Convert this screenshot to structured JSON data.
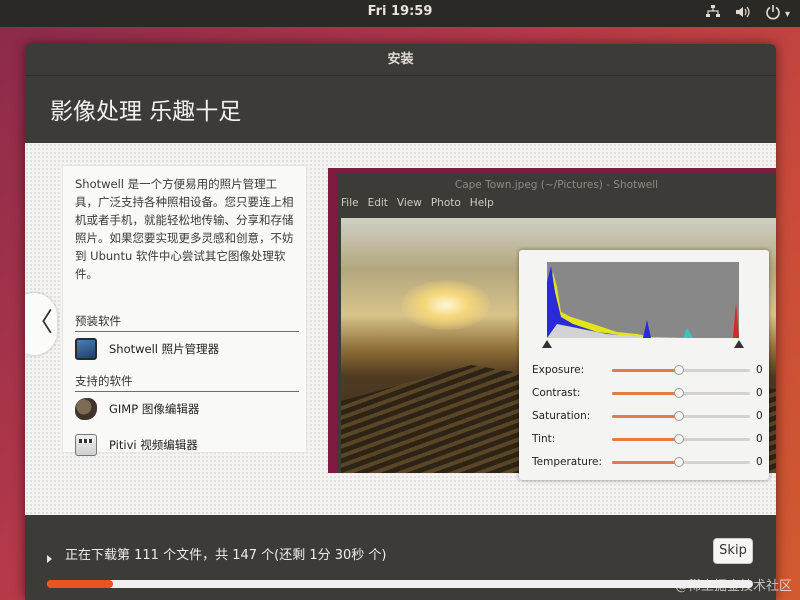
{
  "topbar": {
    "clock": "Fri 19:59",
    "tray_icons": [
      "network-icon",
      "volume-icon",
      "power-icon",
      "chevron-down-icon"
    ]
  },
  "window": {
    "title": "安装",
    "heading": "影像处理 乐趣十足"
  },
  "slide": {
    "description": "Shotwell 是一个方便易用的照片管理工具，广泛支持各种照相设备。您只要连上相机或者手机，就能轻松地传输、分享和存储照片。如果您要实现更多灵感和创意，不妨到 Ubuntu 软件中心尝试其它图像处理软件。",
    "preinstalled_title": "预装软件",
    "preinstalled_apps": [
      {
        "label": "Shotwell 照片管理器",
        "icon": "shotwell-icon"
      }
    ],
    "supported_title": "支持的软件",
    "supported_apps": [
      {
        "label": "GIMP 图像编辑器",
        "icon": "gimp-icon"
      },
      {
        "label": "Pitivi 视频编辑器",
        "icon": "pitivi-icon"
      }
    ],
    "prev_arrow": "〈",
    "next_arrow": "〉"
  },
  "shotwell_preview": {
    "window_title": "Cape Town.jpeg (~/Pictures) - Shotwell",
    "menu": [
      "File",
      "Edit",
      "View",
      "Photo",
      "Help"
    ],
    "adjustments": [
      {
        "label": "Exposure:",
        "value": "0"
      },
      {
        "label": "Contrast:",
        "value": "0"
      },
      {
        "label": "Saturation:",
        "value": "0"
      },
      {
        "label": "Tint:",
        "value": "0"
      },
      {
        "label": "Temperature:",
        "value": "0"
      }
    ],
    "slider_level": 0.48
  },
  "footer": {
    "status": "正在下载第 111 个文件，共 147 个(还剩 1分 30秒 个)",
    "skip_label": "Skip",
    "progress_fraction": 0.094,
    "accent_color": "#e95420"
  },
  "watermark": "@稀土掘金技术社区"
}
